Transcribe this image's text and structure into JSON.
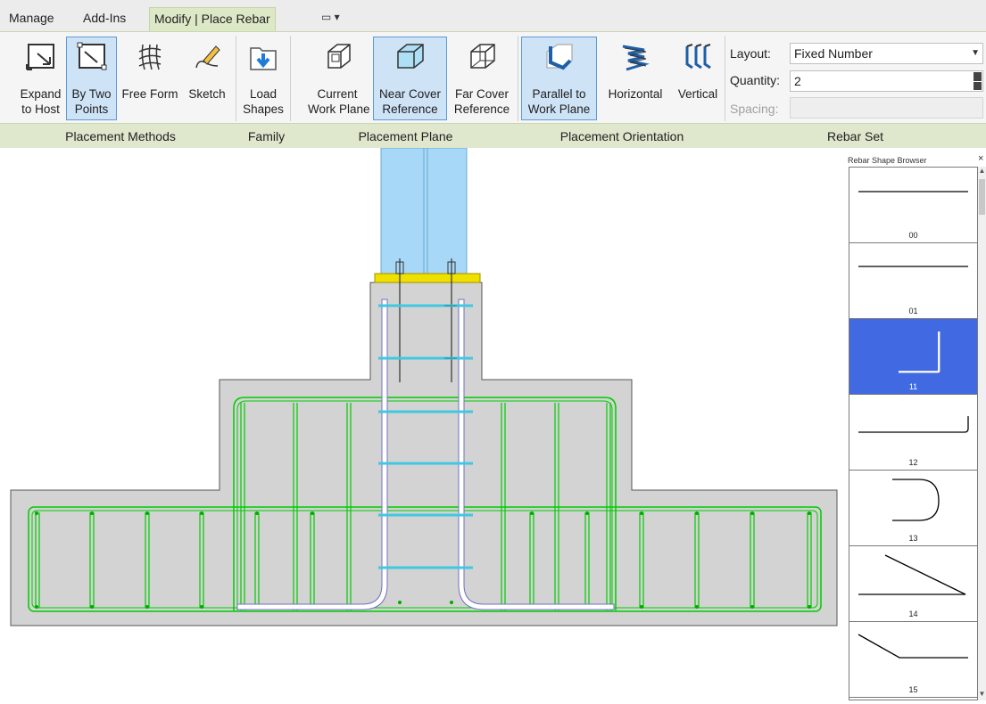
{
  "tabs": {
    "manage": "Manage",
    "add_ins": "Add-Ins",
    "modify_place_rebar": "Modify | Place Rebar",
    "quick_access": "▭ ▾"
  },
  "ribbon": {
    "buttons": {
      "expand_to_host": "Expand\nto Host",
      "by_two_points": "By Two\nPoints",
      "free_form": "Free Form",
      "sketch": "Sketch",
      "load_shapes": "Load\nShapes",
      "current_work_plane": "Current\nWork Plane",
      "near_cover_reference": "Near Cover\nReference",
      "far_cover_reference": "Far Cover\nReference",
      "parallel_to_work_plane": "Parallel to\nWork Plane",
      "horizontal": "Horizontal",
      "vertical": "Vertical"
    },
    "panels": {
      "placement_methods": "Placement Methods",
      "family": "Family",
      "placement_plane": "Placement Plane",
      "placement_orientation": "Placement Orientation",
      "rebar_set": "Rebar Set"
    },
    "rebar_set": {
      "layout_label": "Layout:",
      "layout_value": "Fixed Number",
      "quantity_label": "Quantity:",
      "quantity_value": "2",
      "spacing_label": "Spacing:",
      "spacing_value": ""
    },
    "active_buttons": [
      "by_two_points",
      "near_cover_reference",
      "parallel_to_work_plane"
    ],
    "accent_color": "#5b9bd5",
    "active_fill": "#cfe3f7",
    "panel_label_bg": "#dfe7cc"
  },
  "canvas": {
    "concrete_color": "#d3d3d3",
    "rebar_color": "#00cc00",
    "column_color": "#a8d8f8",
    "base_plate_color": "#f0e000",
    "anchor_rebar_color": "#ffffff"
  },
  "shape_browser": {
    "title": "Rebar Shape Browser",
    "close": "×",
    "selected_color": "#4169e1",
    "shapes": [
      {
        "code": "00",
        "selected": false
      },
      {
        "code": "01",
        "selected": false
      },
      {
        "code": "11",
        "selected": true
      },
      {
        "code": "12",
        "selected": false
      },
      {
        "code": "13",
        "selected": false
      },
      {
        "code": "14",
        "selected": false
      },
      {
        "code": "15",
        "selected": false
      }
    ]
  }
}
